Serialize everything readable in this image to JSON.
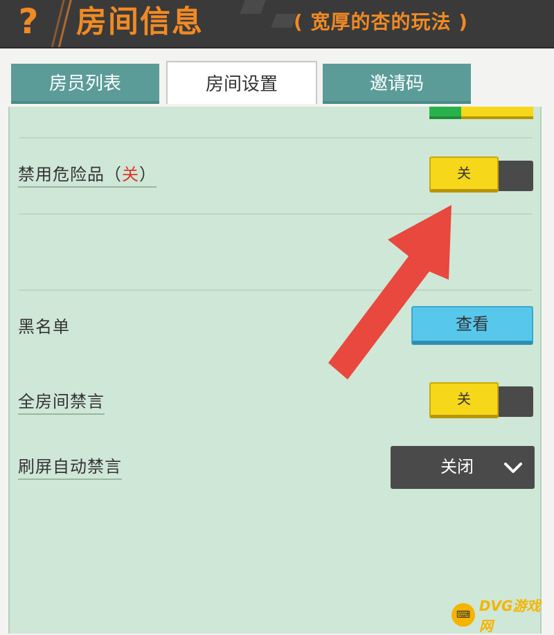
{
  "header": {
    "help_glyph": "?",
    "title": "房间信息",
    "subtitle": "( 宽厚的杏的玩法 )"
  },
  "tabs": [
    {
      "label": "房员列表",
      "active": false
    },
    {
      "label": "房间设置",
      "active": true
    },
    {
      "label": "邀请码",
      "active": false
    }
  ],
  "settings": {
    "ban_dangerous": {
      "label": "禁用危险品（",
      "state_text": "关",
      "label_suffix": "）",
      "toggle_label": "关"
    },
    "blacklist": {
      "label": "黑名单",
      "button_label": "查看"
    },
    "mute_all": {
      "label": "全房间禁言",
      "toggle_label": "关"
    },
    "spam_mute": {
      "label": "刷屏自动禁言",
      "selected": "关闭"
    }
  },
  "watermark": {
    "icon_text": "⌨",
    "text": "DVG游戏网"
  },
  "colors": {
    "accent_orange": "#f08a24",
    "panel_green": "#cfe7d6",
    "tab_teal": "#5b9c98",
    "toggle_yellow": "#f7d71a",
    "button_blue": "#57c8ec",
    "arrow_red": "#e8483e"
  },
  "icons": [
    "help-icon",
    "chevron-down-icon",
    "arrow-annotation"
  ]
}
